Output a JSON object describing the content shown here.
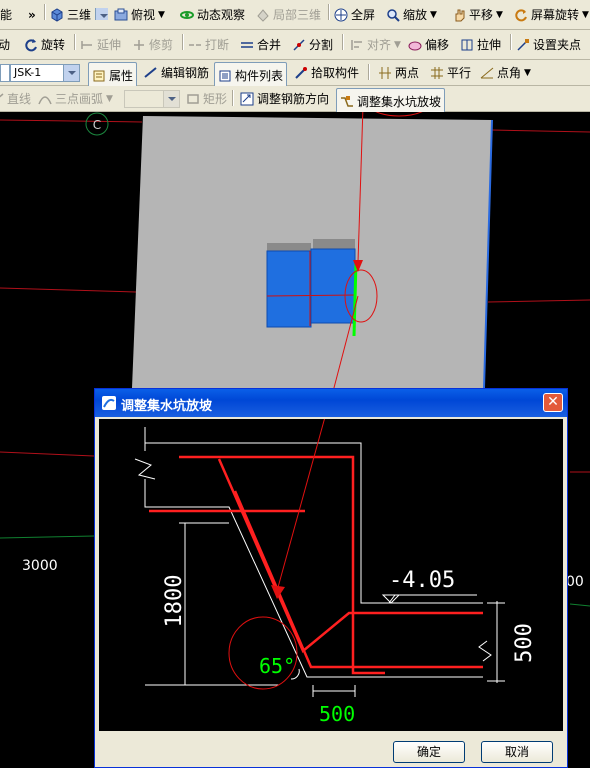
{
  "toolbar1": {
    "items": [
      {
        "label": "三维",
        "icon": "cube-icon"
      },
      {
        "label": "俯视",
        "icon": "top-view-icon"
      },
      {
        "label": "动态观察",
        "icon": "orbit-icon"
      },
      {
        "label": "局部三维",
        "icon": "local-3d-icon"
      },
      {
        "label": "全屏",
        "icon": "fullscreen-icon"
      },
      {
        "label": "缩放",
        "icon": "zoom-icon"
      },
      {
        "label": "平移",
        "icon": "pan-icon"
      },
      {
        "label": "屏幕旋转",
        "icon": "screen-rotate-icon"
      }
    ]
  },
  "toolbar2": {
    "items": [
      {
        "label": "移动"
      },
      {
        "label": "旋转"
      },
      {
        "label": "延伸"
      },
      {
        "label": "修剪"
      },
      {
        "label": "打断"
      },
      {
        "label": "合并"
      },
      {
        "label": "分割"
      },
      {
        "label": "对齐"
      },
      {
        "label": "偏移"
      },
      {
        "label": "拉伸"
      },
      {
        "label": "设置夹点"
      }
    ]
  },
  "toolbar3": {
    "combo_value": "JSK-1",
    "items": [
      {
        "label": "属性"
      },
      {
        "label": "编辑钢筋"
      },
      {
        "label": "构件列表"
      },
      {
        "label": "拾取构件"
      },
      {
        "label": "两点"
      },
      {
        "label": "平行"
      },
      {
        "label": "点角"
      }
    ]
  },
  "toolbar4": {
    "items": [
      {
        "label": "直线"
      },
      {
        "label": "三点画弧"
      },
      {
        "label": "矩形"
      },
      {
        "label": "调整钢筋方向"
      },
      {
        "label": "调整集水坑放坡"
      }
    ]
  },
  "viewport": {
    "axis_label": "C",
    "left_dim": "3000",
    "right_dim": "00"
  },
  "dialog": {
    "title": "调整集水坑放坡",
    "elevation": "-4.05",
    "height_dim": "1800",
    "right_dim": "500",
    "bottom_dim": "500",
    "angle": "65°",
    "ok_label": "确定",
    "cancel_label": "取消"
  },
  "colors": {
    "accent_red": "#ff0000",
    "slope_green": "#00ff00",
    "pit_blue": "#1f6fe0",
    "slab_gray": "#b5b5b5"
  }
}
